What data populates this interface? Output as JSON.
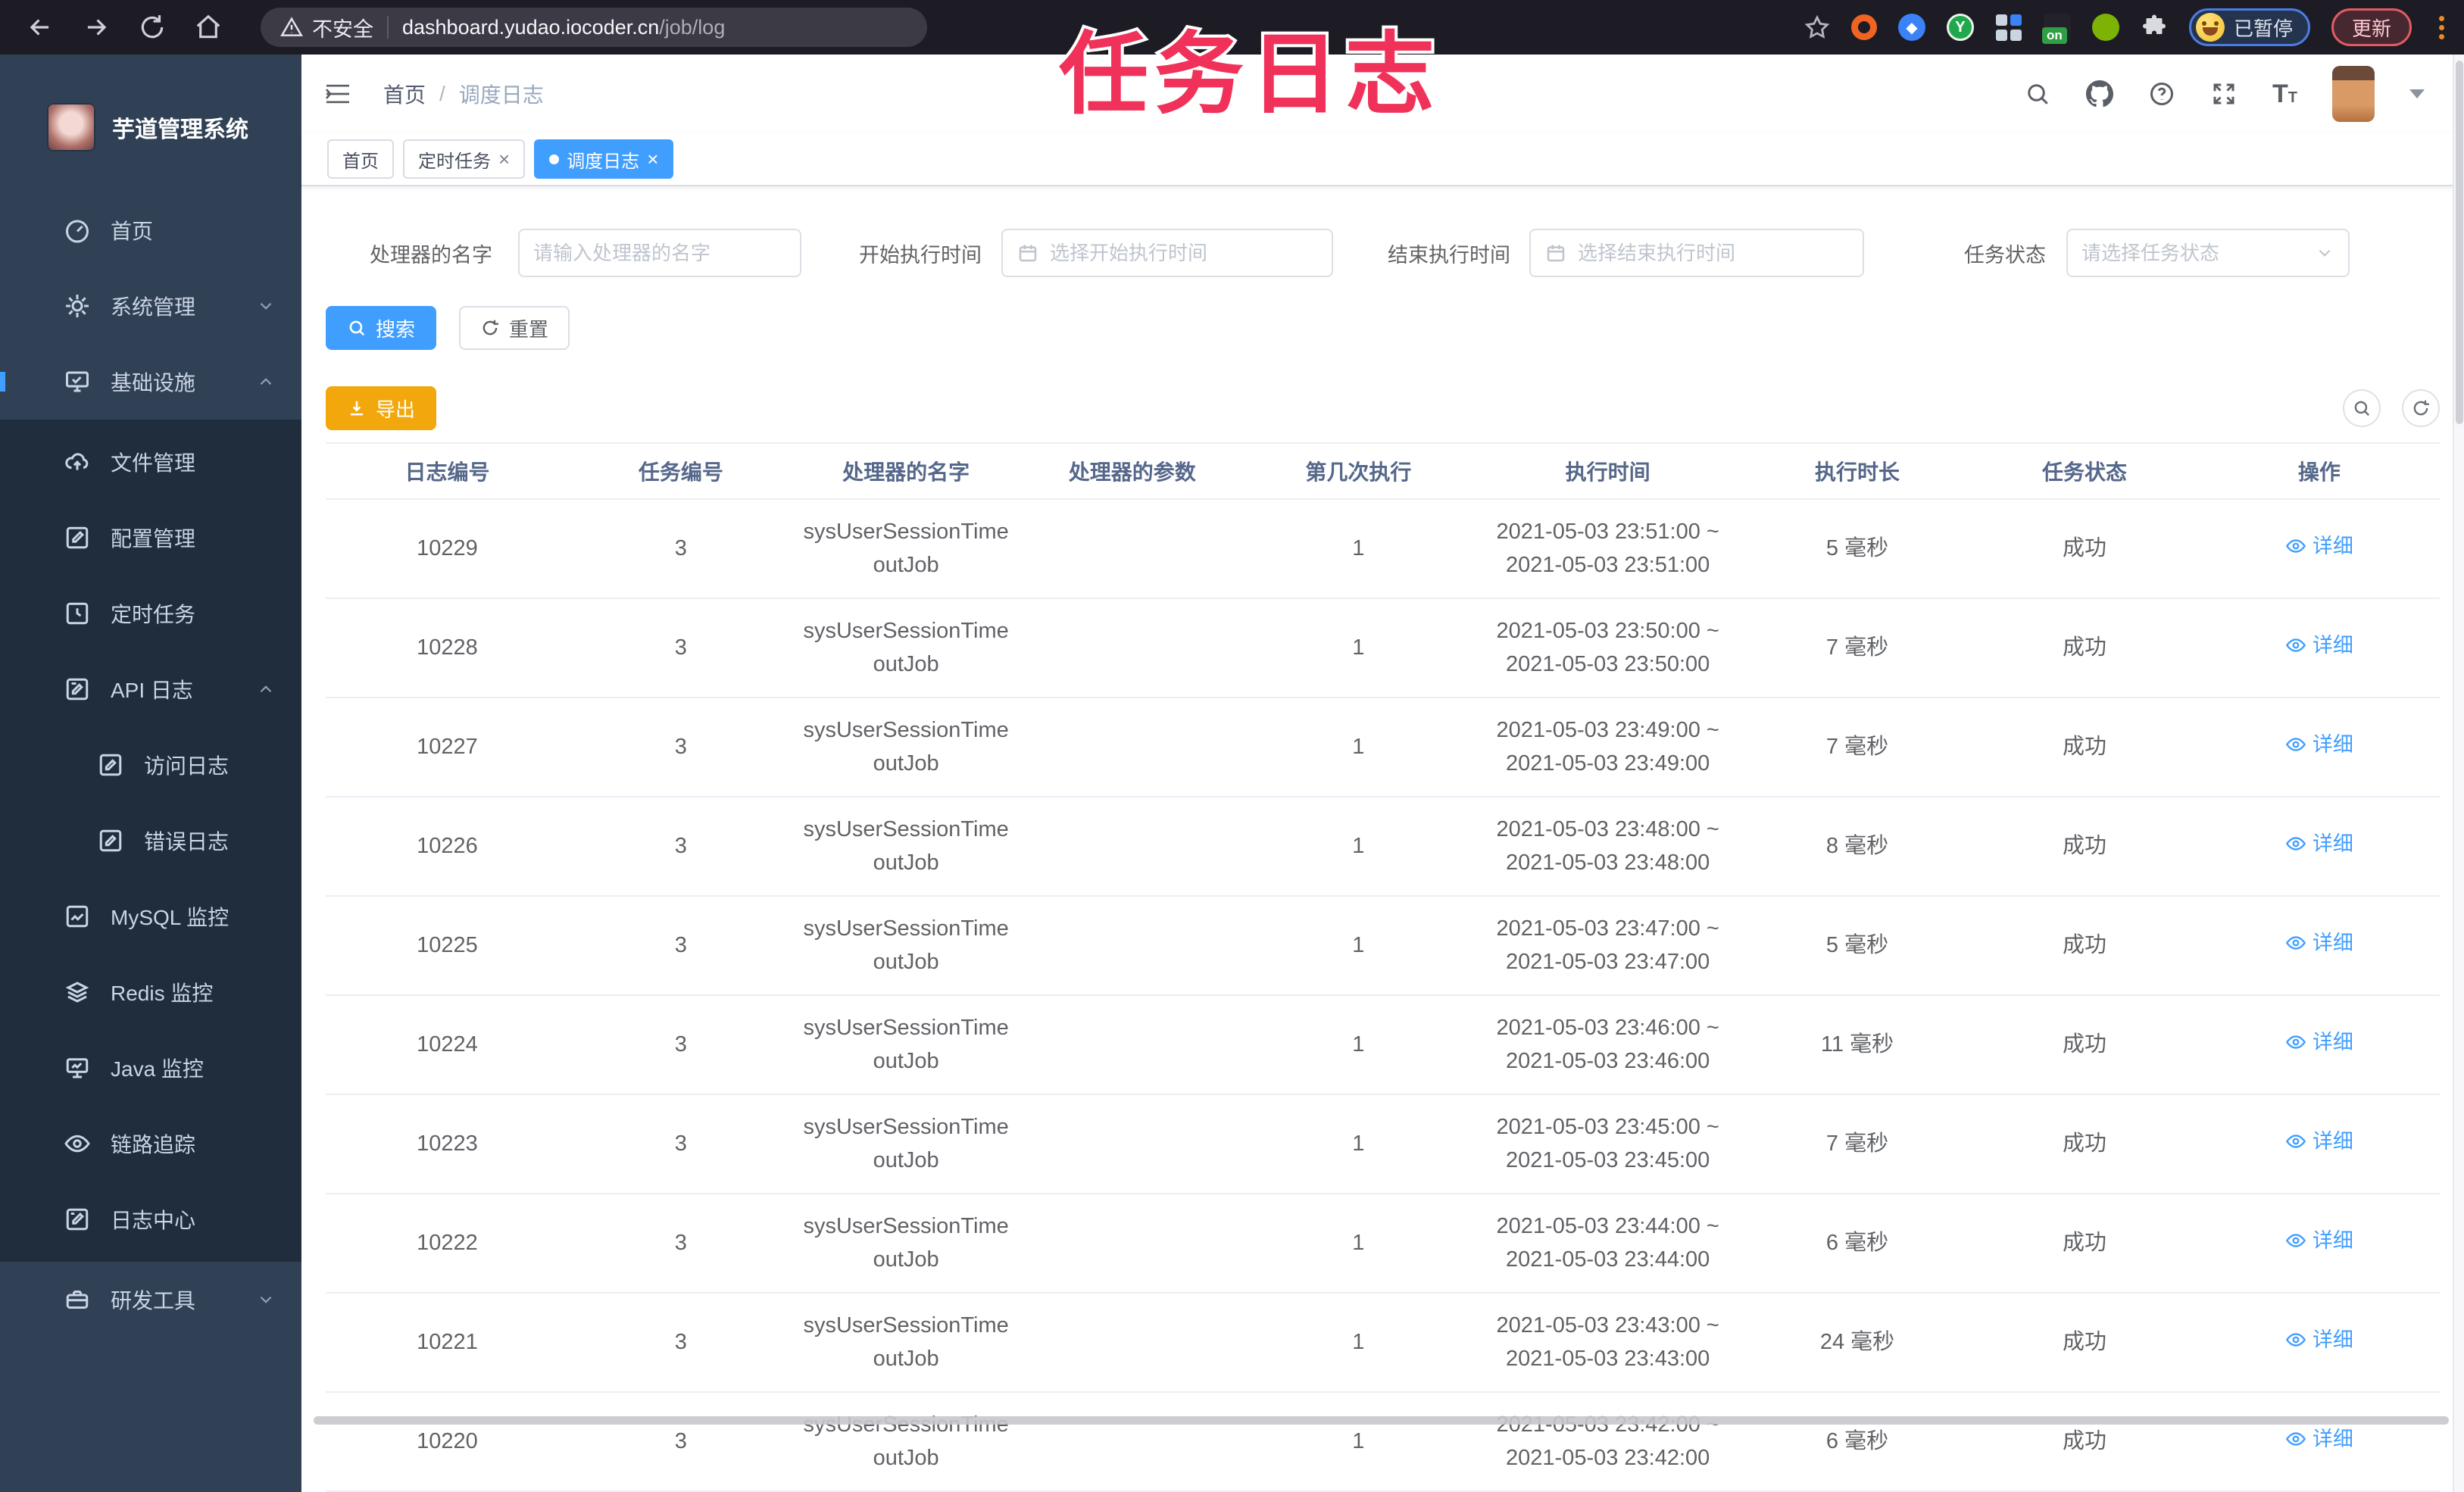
{
  "annotation": {
    "text": "任务日志"
  },
  "browser": {
    "security_label": "不安全",
    "url_host": "dashboard.yudao.iocoder.cn",
    "url_path": "/job/log",
    "extension_on_badge": "on",
    "profile_paused_badge": "已暂停",
    "update_button": "更新"
  },
  "sidebar": {
    "app_title": "芋道管理系统",
    "home": "首页",
    "system": "系统管理",
    "infra": "基础设施",
    "devtools": "研发工具",
    "infra_children": {
      "file": "文件管理",
      "config": "配置管理",
      "job": "定时任务",
      "api_log": "API 日志",
      "access_log": "访问日志",
      "error_log": "错误日志",
      "mysql": "MySQL 监控",
      "redis": "Redis 监控",
      "java": "Java 监控",
      "trace": "链路追踪",
      "log_center": "日志中心"
    }
  },
  "navbar": {
    "breadcrumb_home": "首页",
    "breadcrumb_sep": "/",
    "breadcrumb_current": "调度日志"
  },
  "tags": {
    "home": "首页",
    "job": "定时任务",
    "log": "调度日志"
  },
  "filters": {
    "handler_label": "处理器的名字",
    "handler_placeholder": "请输入处理器的名字",
    "begin_label": "开始执行时间",
    "begin_placeholder": "选择开始执行时间",
    "end_label": "结束执行时间",
    "end_placeholder": "选择结束执行时间",
    "status_label": "任务状态",
    "status_placeholder": "请选择任务状态"
  },
  "actions": {
    "search": "搜索",
    "reset": "重置",
    "export": "导出"
  },
  "table": {
    "headers": [
      "日志编号",
      "任务编号",
      "处理器的名字",
      "处理器的参数",
      "第几次执行",
      "执行时间",
      "执行时长",
      "任务状态",
      "操作"
    ],
    "rows": [
      {
        "id": "10229",
        "job_id": "3",
        "handler": "sysUserSessionTimeoutJob",
        "param": "",
        "exec_index": "1",
        "time_start": "2021-05-03 23:51:00 ~",
        "time_end": "2021-05-03 23:51:00",
        "duration": "5 毫秒",
        "status": "成功",
        "action": "详细"
      },
      {
        "id": "10228",
        "job_id": "3",
        "handler": "sysUserSessionTimeoutJob",
        "param": "",
        "exec_index": "1",
        "time_start": "2021-05-03 23:50:00 ~",
        "time_end": "2021-05-03 23:50:00",
        "duration": "7 毫秒",
        "status": "成功",
        "action": "详细"
      },
      {
        "id": "10227",
        "job_id": "3",
        "handler": "sysUserSessionTimeoutJob",
        "param": "",
        "exec_index": "1",
        "time_start": "2021-05-03 23:49:00 ~",
        "time_end": "2021-05-03 23:49:00",
        "duration": "7 毫秒",
        "status": "成功",
        "action": "详细"
      },
      {
        "id": "10226",
        "job_id": "3",
        "handler": "sysUserSessionTimeoutJob",
        "param": "",
        "exec_index": "1",
        "time_start": "2021-05-03 23:48:00 ~",
        "time_end": "2021-05-03 23:48:00",
        "duration": "8 毫秒",
        "status": "成功",
        "action": "详细"
      },
      {
        "id": "10225",
        "job_id": "3",
        "handler": "sysUserSessionTimeoutJob",
        "param": "",
        "exec_index": "1",
        "time_start": "2021-05-03 23:47:00 ~",
        "time_end": "2021-05-03 23:47:00",
        "duration": "5 毫秒",
        "status": "成功",
        "action": "详细"
      },
      {
        "id": "10224",
        "job_id": "3",
        "handler": "sysUserSessionTimeoutJob",
        "param": "",
        "exec_index": "1",
        "time_start": "2021-05-03 23:46:00 ~",
        "time_end": "2021-05-03 23:46:00",
        "duration": "11 毫秒",
        "status": "成功",
        "action": "详细"
      },
      {
        "id": "10223",
        "job_id": "3",
        "handler": "sysUserSessionTimeoutJob",
        "param": "",
        "exec_index": "1",
        "time_start": "2021-05-03 23:45:00 ~",
        "time_end": "2021-05-03 23:45:00",
        "duration": "7 毫秒",
        "status": "成功",
        "action": "详细"
      },
      {
        "id": "10222",
        "job_id": "3",
        "handler": "sysUserSessionTimeoutJob",
        "param": "",
        "exec_index": "1",
        "time_start": "2021-05-03 23:44:00 ~",
        "time_end": "2021-05-03 23:44:00",
        "duration": "6 毫秒",
        "status": "成功",
        "action": "详细"
      },
      {
        "id": "10221",
        "job_id": "3",
        "handler": "sysUserSessionTimeoutJob",
        "param": "",
        "exec_index": "1",
        "time_start": "2021-05-03 23:43:00 ~",
        "time_end": "2021-05-03 23:43:00",
        "duration": "24 毫秒",
        "status": "成功",
        "action": "详细"
      },
      {
        "id": "10220",
        "job_id": "3",
        "handler": "sysUserSessionTimeoutJob",
        "param": "",
        "exec_index": "1",
        "time_start": "2021-05-03 23:42:00 ~",
        "time_end": "2021-05-03 23:42:00",
        "duration": "6 毫秒",
        "status": "成功",
        "action": "详细"
      }
    ]
  },
  "colors": {
    "primary": "#409EFF",
    "warning": "#F2A80D",
    "annotation": "#F0325A",
    "sidebar-bg": "#304156",
    "submenu-bg": "#1F2D3D",
    "chrome-bg": "#1D1C24"
  }
}
